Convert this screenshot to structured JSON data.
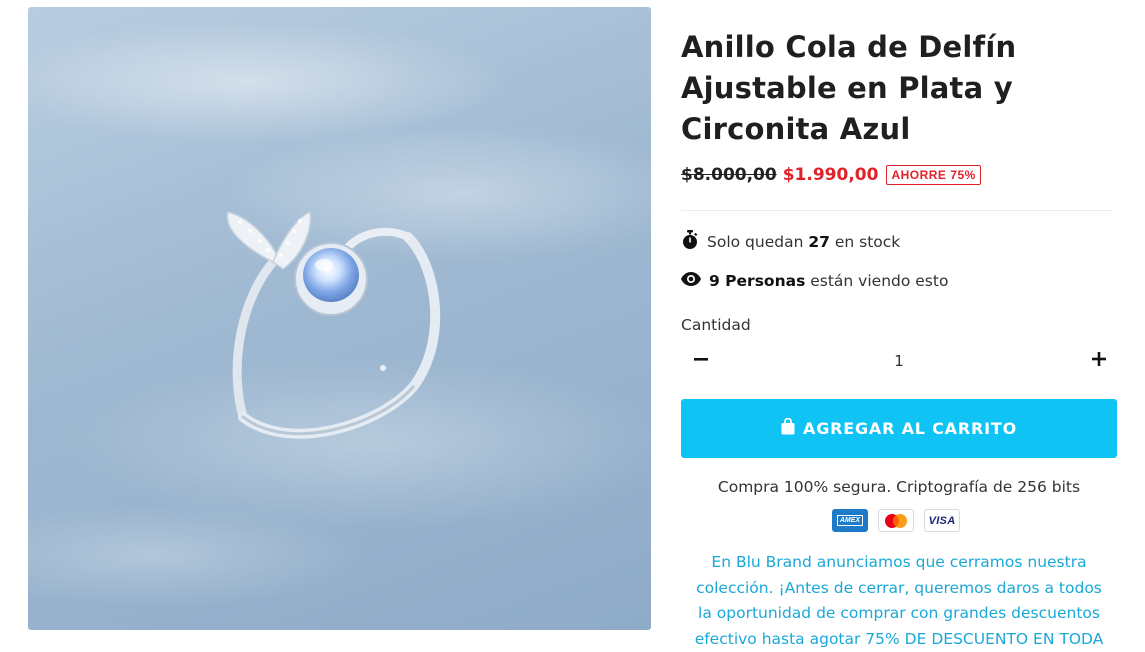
{
  "product": {
    "title_lines": [
      "Anillo Cola de Delfín",
      "Ajustable en Plata y",
      "Circonita Azul"
    ],
    "image_alt": "anillo-cola-de-delfin-image"
  },
  "pricing": {
    "old_price": "$8.000,00",
    "new_price": "$1.990,00",
    "save_badge": "AHORRE 75%"
  },
  "stock": {
    "prefix": "Solo quedan",
    "count": "27",
    "suffix": "en stock",
    "icon": "stopwatch-icon"
  },
  "viewers": {
    "highlight": "9 Personas",
    "suffix": "están viendo esto",
    "icon": "eye-icon"
  },
  "quantity": {
    "label": "Cantidad",
    "value": "1",
    "minus_icon": "minus-icon",
    "plus_icon": "plus-icon"
  },
  "cart": {
    "button_label": "AGREGAR AL CARRITO",
    "icon": "shopping-bag-icon"
  },
  "security": {
    "text": "Compra 100% segura. Criptografía de 256 bits"
  },
  "payments": {
    "amex": "AMEX",
    "visa": "VISA",
    "mastercard": "mastercard"
  },
  "announcement": {
    "lines": [
      "En Blu Brand anunciamos que cerramos nuestra",
      "colección. ¡Antes de cerrar, queremos daros a todos",
      "la oportunidad de comprar con grandes descuentos",
      "efectivo hasta agotar 75% DE DESCUENTO EN TODA"
    ]
  },
  "colors": {
    "accent": "#0fc4f5",
    "sale_red": "#e0222a",
    "announcement_blue": "#1aa8d8"
  }
}
